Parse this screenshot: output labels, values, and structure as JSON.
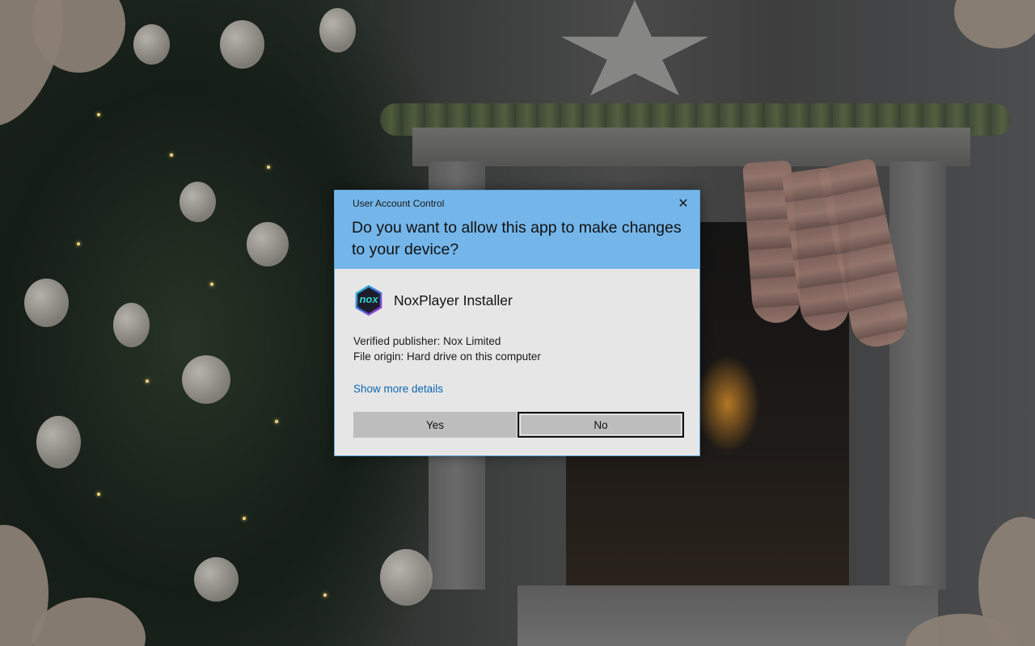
{
  "dialog": {
    "title": "User Account Control",
    "close_glyph": "✕",
    "question": "Do you want to allow this app to make changes to your device?",
    "app_name": "NoxPlayer Installer",
    "app_icon_text": "nox",
    "publisher": "Verified publisher: Nox Limited",
    "origin": "File origin: Hard drive on this computer",
    "details_link": "Show more details",
    "yes_label": "Yes",
    "no_label": "No",
    "colors": {
      "header": "#74b6ea",
      "body": "#e6e6e6",
      "link": "#0f67b0",
      "button": "#bdbdbd"
    }
  },
  "background": {
    "description_icons": [
      "christmas-tree",
      "fireplace",
      "star-decoration",
      "stockings",
      "mouse-cursor"
    ]
  }
}
